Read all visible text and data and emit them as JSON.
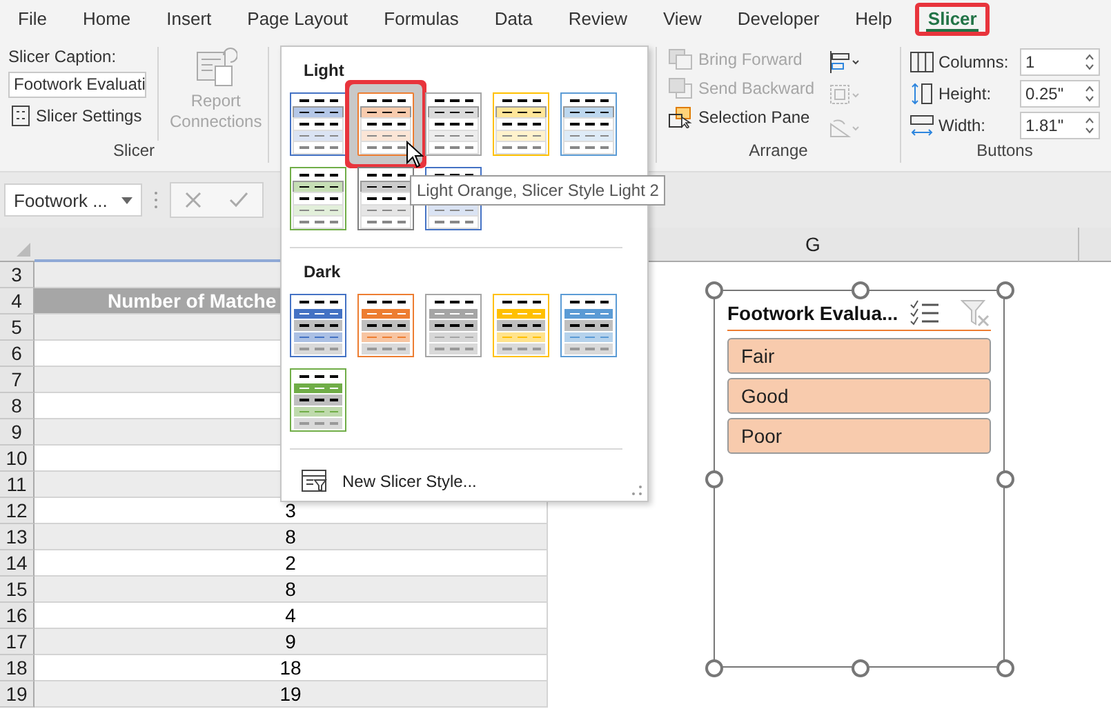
{
  "ribbon_tabs": [
    {
      "label": "File",
      "selected": false
    },
    {
      "label": "Home",
      "selected": false
    },
    {
      "label": "Insert",
      "selected": false
    },
    {
      "label": "Page Layout",
      "selected": false
    },
    {
      "label": "Formulas",
      "selected": false
    },
    {
      "label": "Data",
      "selected": false
    },
    {
      "label": "Review",
      "selected": false
    },
    {
      "label": "View",
      "selected": false
    },
    {
      "label": "Developer",
      "selected": false
    },
    {
      "label": "Help",
      "selected": false
    },
    {
      "label": "Slicer",
      "selected": true
    }
  ],
  "slicer_group": {
    "caption_label": "Slicer Caption:",
    "caption_value": "Footwork Evaluati",
    "settings_button": "Slicer Settings",
    "report_connections": {
      "lines": [
        "Report",
        "Connections"
      ],
      "disabled": true
    },
    "group_label": "Slicer"
  },
  "arrange_group": {
    "buttons": [
      {
        "label": "Bring Forward",
        "disabled": true
      },
      {
        "label": "Send Backward",
        "disabled": true
      },
      {
        "label": "Selection Pane",
        "disabled": false
      }
    ],
    "group_label": "Arrange"
  },
  "buttons_group": {
    "fields": [
      {
        "label": "Columns:",
        "value": "1"
      },
      {
        "label": "Height:",
        "value": "0.25\""
      },
      {
        "label": "Width:",
        "value": "1.81\""
      }
    ],
    "group_label": "Buttons"
  },
  "formula_bar": {
    "name_box": "Footwork ..."
  },
  "sheet": {
    "column_header": "G",
    "rows": [
      {
        "number": "3",
        "kind": "blank"
      },
      {
        "number": "4",
        "kind": "header",
        "value": "Number of Matche"
      },
      {
        "number": "5",
        "kind": "blank"
      },
      {
        "number": "6",
        "kind": "blank"
      },
      {
        "number": "7",
        "kind": "blank"
      },
      {
        "number": "8",
        "kind": "blank"
      },
      {
        "number": "9",
        "kind": "blank"
      },
      {
        "number": "10",
        "kind": "blank"
      },
      {
        "number": "11",
        "kind": "blank"
      },
      {
        "number": "12",
        "kind": "data",
        "value": "3"
      },
      {
        "number": "13",
        "kind": "data",
        "value": "8"
      },
      {
        "number": "14",
        "kind": "data",
        "value": "2"
      },
      {
        "number": "15",
        "kind": "data",
        "value": "8"
      },
      {
        "number": "16",
        "kind": "data",
        "value": "4"
      },
      {
        "number": "17",
        "kind": "data",
        "value": "9"
      },
      {
        "number": "18",
        "kind": "data",
        "value": "18"
      },
      {
        "number": "19",
        "kind": "data",
        "value": "19"
      }
    ]
  },
  "style_gallery": {
    "sections": [
      {
        "title": "Light",
        "kind": "light",
        "styles": [
          {
            "color": "#4472c4",
            "selected": false
          },
          {
            "color": "#ed7d31",
            "selected": true
          },
          {
            "color": "#a5a5a5",
            "selected": false
          },
          {
            "color": "#ffc000",
            "selected": false
          },
          {
            "color": "#5b9bd5",
            "selected": false
          },
          {
            "color": "#70ad47",
            "selected": false
          },
          {
            "color": "#7f7f7f",
            "selected": false
          },
          {
            "color": "#4472c4",
            "selected": false
          }
        ]
      },
      {
        "title": "Dark",
        "kind": "dark",
        "styles": [
          {
            "color": "#4472c4",
            "selected": false
          },
          {
            "color": "#ed7d31",
            "selected": false
          },
          {
            "color": "#a5a5a5",
            "selected": false
          },
          {
            "color": "#ffc000",
            "selected": false
          },
          {
            "color": "#5b9bd5",
            "selected": false
          },
          {
            "color": "#70ad47",
            "selected": false
          }
        ]
      }
    ],
    "new_style": "New Slicer Style..."
  },
  "tooltip": "Light Orange, Slicer Style Light 2",
  "slicer": {
    "title": "Footwork Evalua...",
    "items": [
      {
        "label": "Fair",
        "selected": true
      },
      {
        "label": "Good",
        "selected": true
      },
      {
        "label": "Poor",
        "selected": true
      }
    ]
  }
}
